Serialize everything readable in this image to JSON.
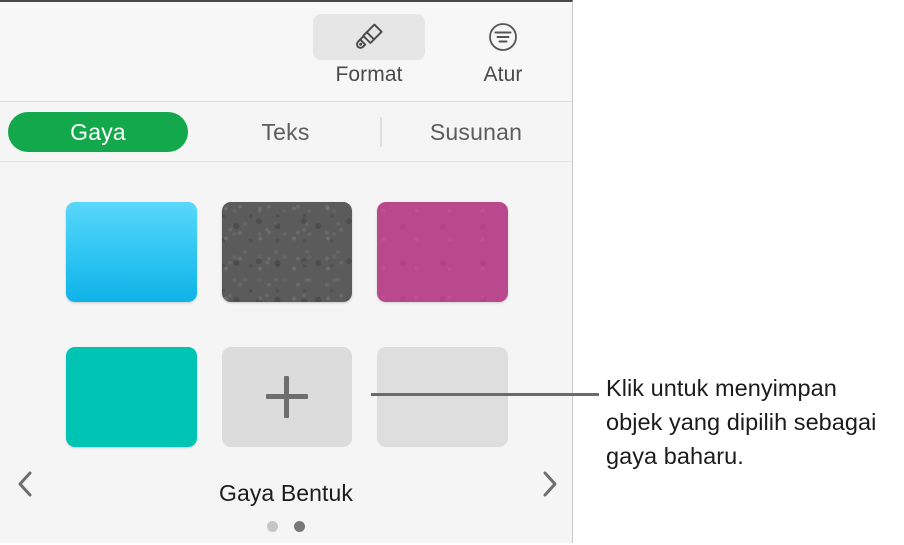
{
  "toolbar": {
    "buttons": [
      {
        "label": "Format",
        "icon": "paintbrush-icon",
        "selected": true
      },
      {
        "label": "Atur",
        "icon": "arrange-align-icon",
        "selected": false
      }
    ]
  },
  "tabs": [
    {
      "label": "Gaya",
      "active": true
    },
    {
      "label": "Teks",
      "active": false
    },
    {
      "label": "Susunan",
      "active": false
    }
  ],
  "styles_panel": {
    "title": "Gaya Bentuk",
    "prev_arrow": "chevron-left-icon",
    "next_arrow": "chevron-right-icon",
    "swatches": [
      {
        "name": "style-swatch-blue-gradient",
        "kind": "color",
        "color": "#34c8f4"
      },
      {
        "name": "style-swatch-gray-texture",
        "kind": "texture",
        "color": "#5b5b5b"
      },
      {
        "name": "style-swatch-pink",
        "kind": "texture",
        "color": "#b9488c"
      },
      {
        "name": "style-swatch-teal",
        "kind": "color",
        "color": "#00c4b3"
      },
      {
        "name": "style-swatch-add-new",
        "kind": "add",
        "color": "#dcdcdc",
        "icon": "plus-icon"
      },
      {
        "name": "style-swatch-empty",
        "kind": "empty",
        "color": "#dedede"
      }
    ],
    "page_dots": [
      {
        "active": false
      },
      {
        "active": true
      }
    ]
  },
  "callout": {
    "text": "Klik untuk menyimpan objek yang dipilih sebagai gaya baharu."
  },
  "colors": {
    "accent_green": "#13a84b",
    "panel_background": "#f5f5f5",
    "toolbar_background": "#f7f7f7",
    "text_primary": "#1c1c1c",
    "text_secondary": "#5c5c5c"
  }
}
